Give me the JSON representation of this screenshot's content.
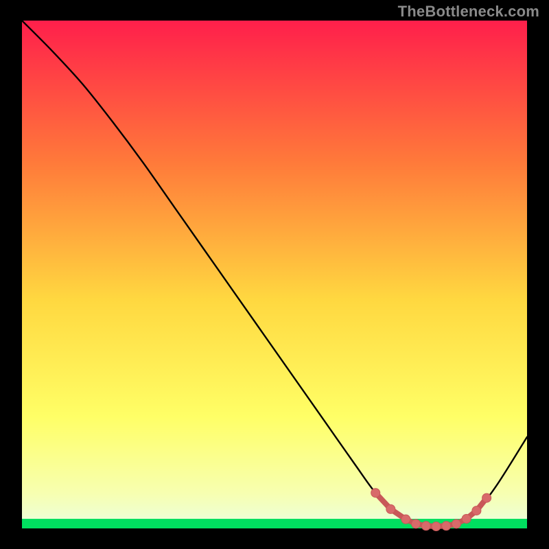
{
  "watermark": "TheBottleneck.com",
  "colors": {
    "gradient_top": "#ff1f4b",
    "gradient_mid1": "#ff7a3a",
    "gradient_mid2": "#ffd840",
    "gradient_mid3": "#ffff66",
    "gradient_mid4": "#f7ffb0",
    "gradient_bottom_band": "#00e060",
    "curve": "#000000",
    "marker_fill": "#d86a6a",
    "marker_stroke": "#c85858"
  },
  "chart_data": {
    "type": "line",
    "title": "",
    "xlabel": "",
    "ylabel": "",
    "xlim": [
      0,
      100
    ],
    "ylim": [
      0,
      100
    ],
    "grid": false,
    "legend": false,
    "series": [
      {
        "name": "bottleneck-curve",
        "x": [
          0,
          6,
          12,
          18,
          24,
          30,
          36,
          42,
          48,
          54,
          60,
          66,
          70,
          74,
          78,
          82,
          86,
          90,
          94,
          100
        ],
        "y": [
          100,
          94,
          87.5,
          80,
          72,
          63.5,
          55,
          46.5,
          38,
          29.5,
          21,
          12.5,
          7,
          3,
          0.8,
          0.4,
          0.8,
          3.5,
          8.5,
          18
        ]
      }
    ],
    "markers": {
      "name": "highlighted-range",
      "x": [
        70,
        73,
        76,
        78,
        80,
        82,
        84,
        86,
        88,
        90,
        92
      ],
      "y": [
        7,
        3.8,
        1.8,
        0.9,
        0.5,
        0.4,
        0.5,
        0.9,
        1.9,
        3.5,
        6
      ]
    }
  }
}
